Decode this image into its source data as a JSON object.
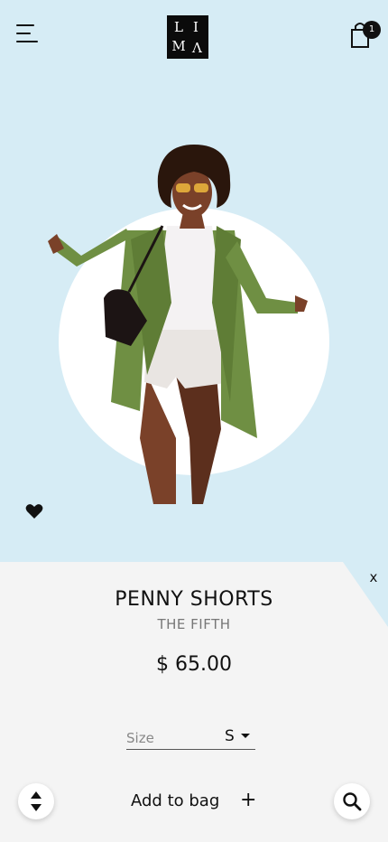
{
  "header": {
    "logo_letters": [
      "L",
      "I",
      "M",
      "V"
    ],
    "cart_count": "1"
  },
  "product": {
    "title": "PENNY SHORTS",
    "brand": "THE FIFTH",
    "price": "$ 65.00"
  },
  "panel": {
    "close_label": "x",
    "size_label": "Size",
    "size_value": "S",
    "add_to_bag_label": "Add to bag",
    "add_icon": "+"
  },
  "icons": {
    "menu": "hamburger-menu-icon",
    "cart": "shopping-bag-icon",
    "favorite": "heart-icon",
    "sort": "sort-icon",
    "search": "search-icon"
  },
  "colors": {
    "hero_background": "#d6ecf5",
    "panel_background": "#f4f4f4",
    "circle": "#ffffff",
    "text": "#111111"
  }
}
